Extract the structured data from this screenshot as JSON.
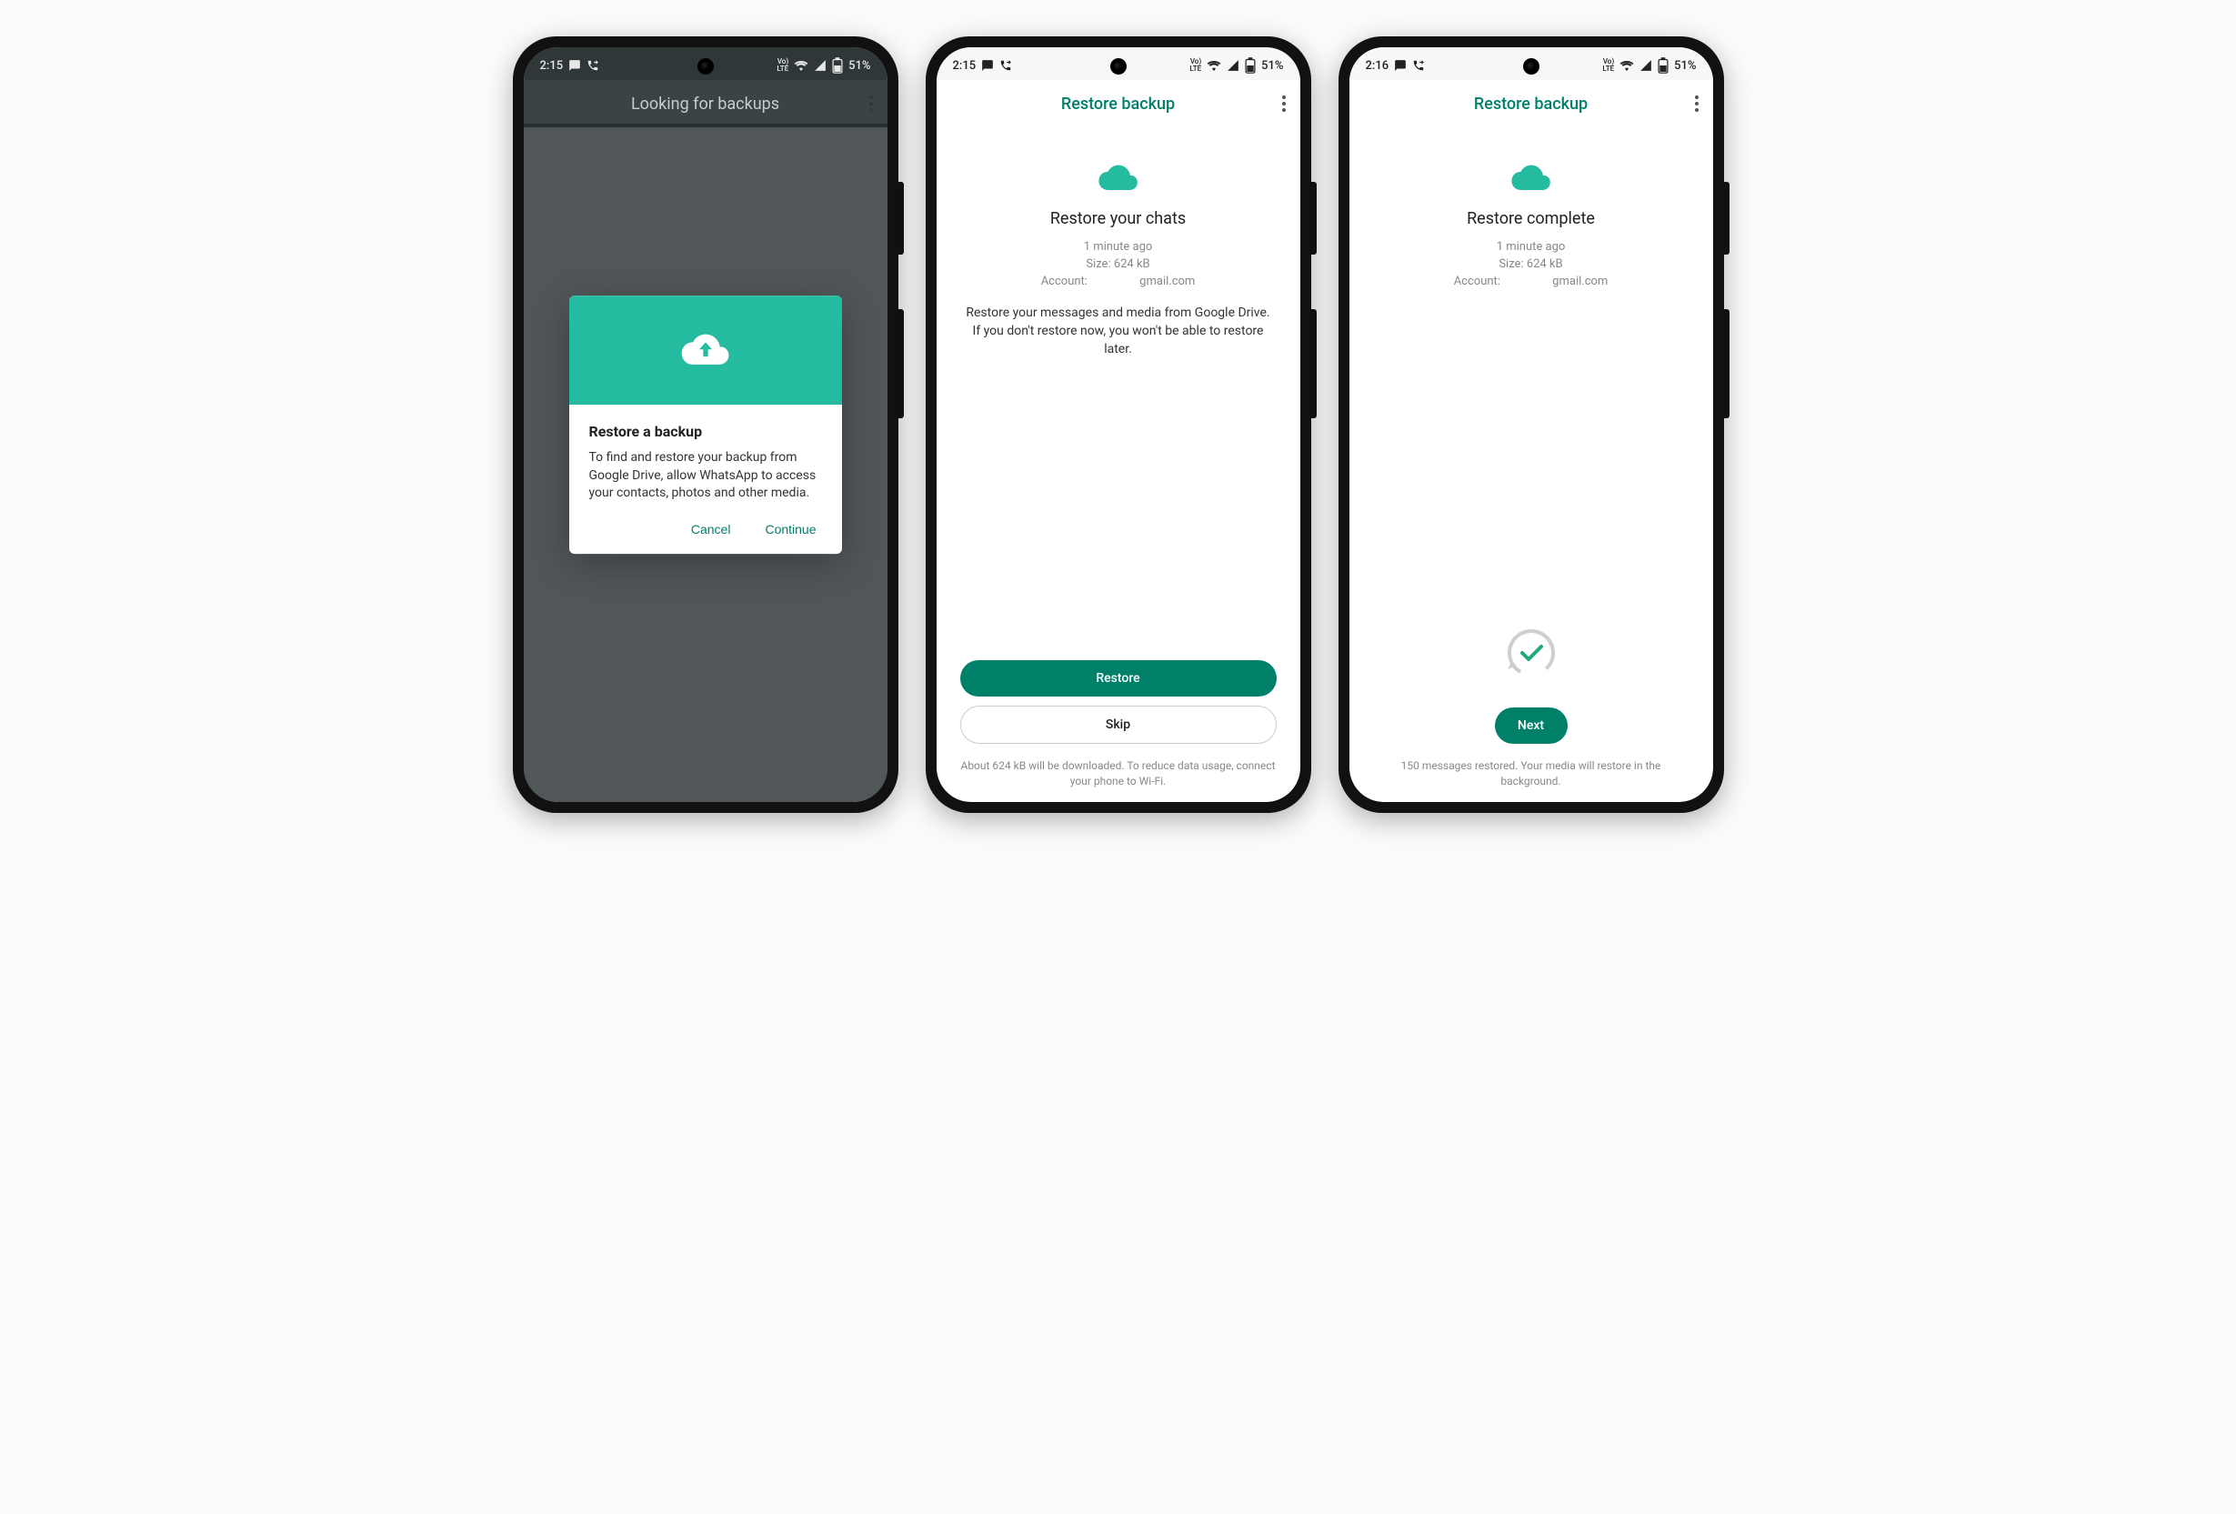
{
  "colors": {
    "accent": "#008069",
    "accent_light": "#25bba0"
  },
  "statusbar": {
    "time_a": "2:15",
    "time_b": "2:16",
    "lte": "Vo\nLTE",
    "battery": "51%"
  },
  "screen1": {
    "app_title": "Looking for backups",
    "dialog": {
      "title": "Restore a backup",
      "body": "To find and restore your backup from Google Drive, allow WhatsApp to access your contacts, photos and other media.",
      "cancel": "Cancel",
      "continue": "Continue"
    }
  },
  "screen2": {
    "app_title": "Restore backup",
    "heading": "Restore your chats",
    "meta_line1": "1 minute ago",
    "meta_line2": "Size: 624 kB",
    "meta_account_label": "Account: ",
    "meta_account_domain": "gmail.com",
    "desc": "Restore your messages and media from Google Drive. If you don't restore now, you won't be able to restore later.",
    "restore_btn": "Restore",
    "skip_btn": "Skip",
    "footer": "About 624 kB will be downloaded. To reduce data usage, connect your phone to Wi-Fi."
  },
  "screen3": {
    "app_title": "Restore backup",
    "heading": "Restore complete",
    "meta_line1": "1 minute ago",
    "meta_line2": "Size: 624 kB",
    "meta_account_label": "Account: ",
    "meta_account_domain": "gmail.com",
    "next_btn": "Next",
    "footer": "150 messages restored. Your media will restore in the background."
  }
}
